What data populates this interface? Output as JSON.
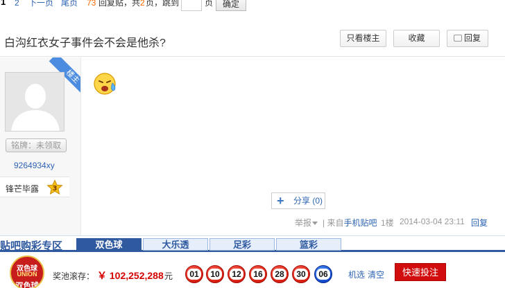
{
  "pager": {
    "current": "1",
    "page2": "2",
    "next": "下一页",
    "last": "尾页",
    "reply_count": "73",
    "reply_label": "回复贴，共",
    "pages": "2",
    "pages_label": "页，跳到",
    "page_suffix": "页",
    "jump_value": "",
    "confirm": "确定"
  },
  "thread": {
    "title": "白沟红衣女子事件会不会是他杀?",
    "only_op": "只看楼主",
    "favorite": "收藏",
    "reply": "回复"
  },
  "author": {
    "ribbon": "楼主",
    "badge": "铭牌：未领取",
    "username": "9264934xy",
    "level_name": "锋芒毕露",
    "level": "3"
  },
  "post": {
    "share": "分享",
    "share_count": "(0)",
    "report": "举报",
    "source_prefix": "| 来自",
    "source_link": "手机贴吧",
    "floor": "1楼",
    "datetime": "2014-03-04 23:11",
    "reply": "回复"
  },
  "lottery": {
    "zone": "贴吧购彩专区",
    "tabs": [
      "双色球",
      "大乐透",
      "足彩",
      "篮彩"
    ],
    "active_tab": "双色球",
    "logo_lines": [
      "双色球",
      "UNION",
      "双色球"
    ],
    "pool_label": "奖池滚存：",
    "pool_amount": "￥ 102,252,288",
    "pool_unit": "元",
    "red_balls": [
      "01",
      "10",
      "12",
      "16",
      "28",
      "30"
    ],
    "blue_ball": "06",
    "random_pick": "机选",
    "clear": "清空",
    "bet_button": "快速投注"
  },
  "colors": {
    "link": "#2d64b3",
    "accent_red": "#d10d0d",
    "nav_blue": "#2f5aa0"
  }
}
